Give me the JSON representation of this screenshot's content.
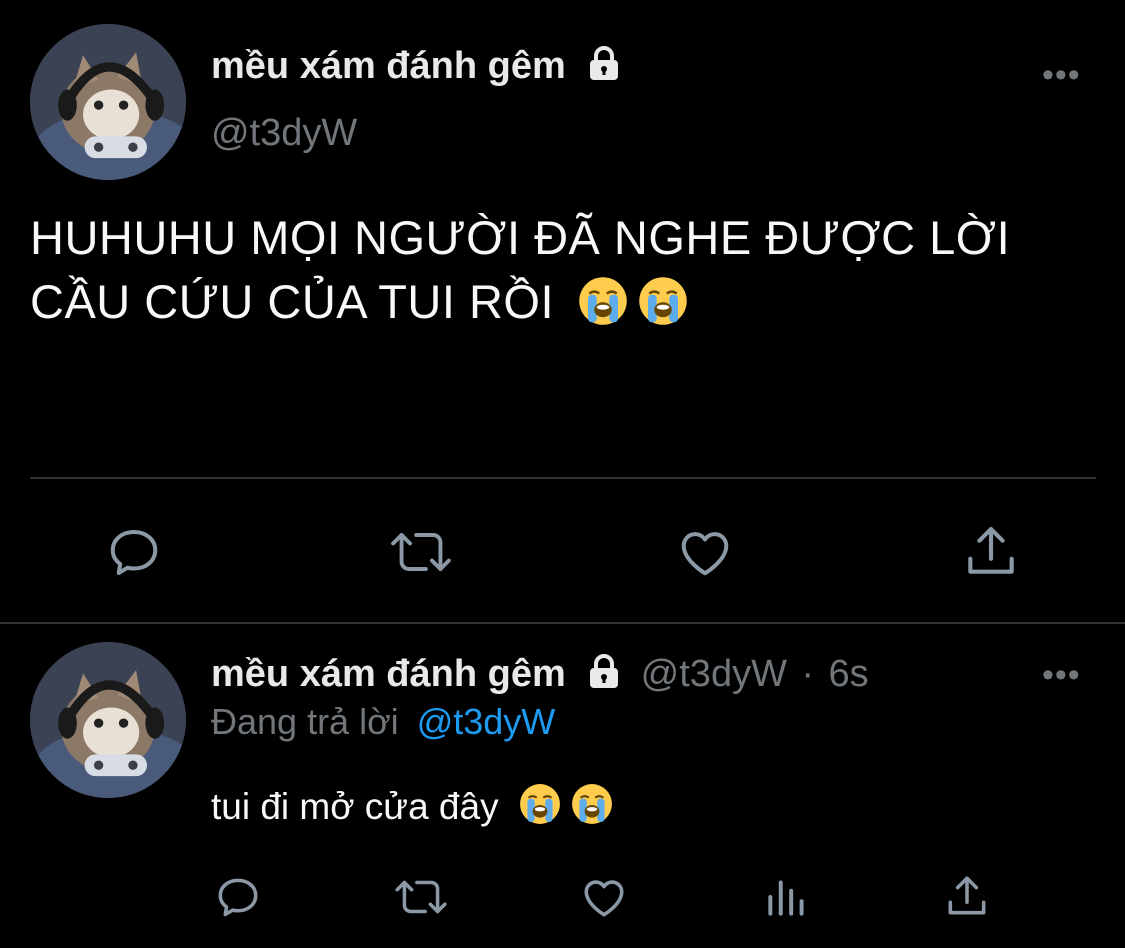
{
  "main_tweet": {
    "display_name": "mều xám đánh gêm",
    "handle": "@t3dyW",
    "text": "HUHUHU MỌI NGƯỜI ĐÃ NGHE ĐƯỢC LỜI CẦU CỨU CỦA TUI RỒI",
    "more_label": "•••",
    "emoji_names": [
      "loudly-crying-face",
      "loudly-crying-face"
    ],
    "actions": [
      "reply",
      "retweet",
      "like",
      "share"
    ]
  },
  "reply_tweet": {
    "display_name": "mều xám đánh gêm",
    "handle": "@t3dyW",
    "separator": "·",
    "time": "6s",
    "replying_prefix": "Đang trả lời",
    "replying_to": "@t3dyW",
    "text": "tui đi mở cửa đây",
    "more_label": "•••",
    "emoji_names": [
      "loudly-crying-face",
      "loudly-crying-face"
    ],
    "actions": [
      "reply",
      "retweet",
      "like",
      "analytics",
      "share"
    ]
  },
  "colors": {
    "background": "#000000",
    "text": "#e7e9ea",
    "muted": "#71767b",
    "accent": "#1d9bf0",
    "divider": "#2f3336"
  }
}
